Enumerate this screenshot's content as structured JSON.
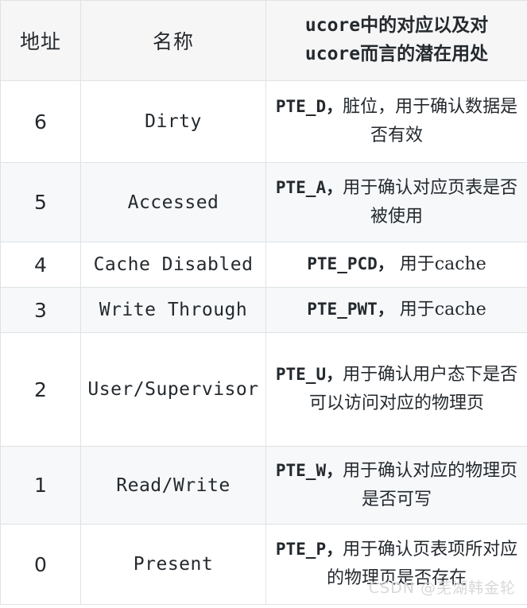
{
  "table": {
    "headers": {
      "address": "地址",
      "name": "名称",
      "description_line1": "ucore中的对应以及对",
      "description_line2": "ucore而言的潜在用处"
    },
    "rows": [
      {
        "address": "6",
        "name": "Dirty",
        "desc_pte": "PTE_D，",
        "desc_text": "脏位，用于确认数据是否有效",
        "stripe": "white"
      },
      {
        "address": "5",
        "name": "Accessed",
        "desc_pte": "PTE_A，",
        "desc_text": "用于确认对应页表是否被使用",
        "stripe": "gray"
      },
      {
        "address": "4",
        "name": "Cache Disabled",
        "desc_pte": "PTE_PCD，",
        "desc_text": " 用于cache",
        "stripe": "white"
      },
      {
        "address": "3",
        "name": "Write Through",
        "desc_pte": "PTE_PWT，",
        "desc_text": " 用于cache",
        "stripe": "gray"
      },
      {
        "address": "2",
        "name": "User/Supervisor",
        "desc_pte": "PTE_U，",
        "desc_text": "用于确认用户态下是否可以访问对应的物理页",
        "stripe": "white"
      },
      {
        "address": "1",
        "name": "Read/Write",
        "desc_pte": "PTE_W，",
        "desc_text": "用于确认对应的物理页是否可写",
        "stripe": "gray"
      },
      {
        "address": "0",
        "name": "Present",
        "desc_pte": "PTE_P，",
        "desc_text": "用于确认页表项所对应的物理页是否存在",
        "stripe": "white"
      }
    ]
  },
  "watermark": {
    "text": "CSDN @芜湖韩金轮",
    "color": "#d8d8d8"
  },
  "colors": {
    "border": "#dfe2e5",
    "header_background": "#f6f6f6",
    "stripe_background": "#f6f8fa",
    "row_background": "#ffffff",
    "text": "#2b3137"
  }
}
